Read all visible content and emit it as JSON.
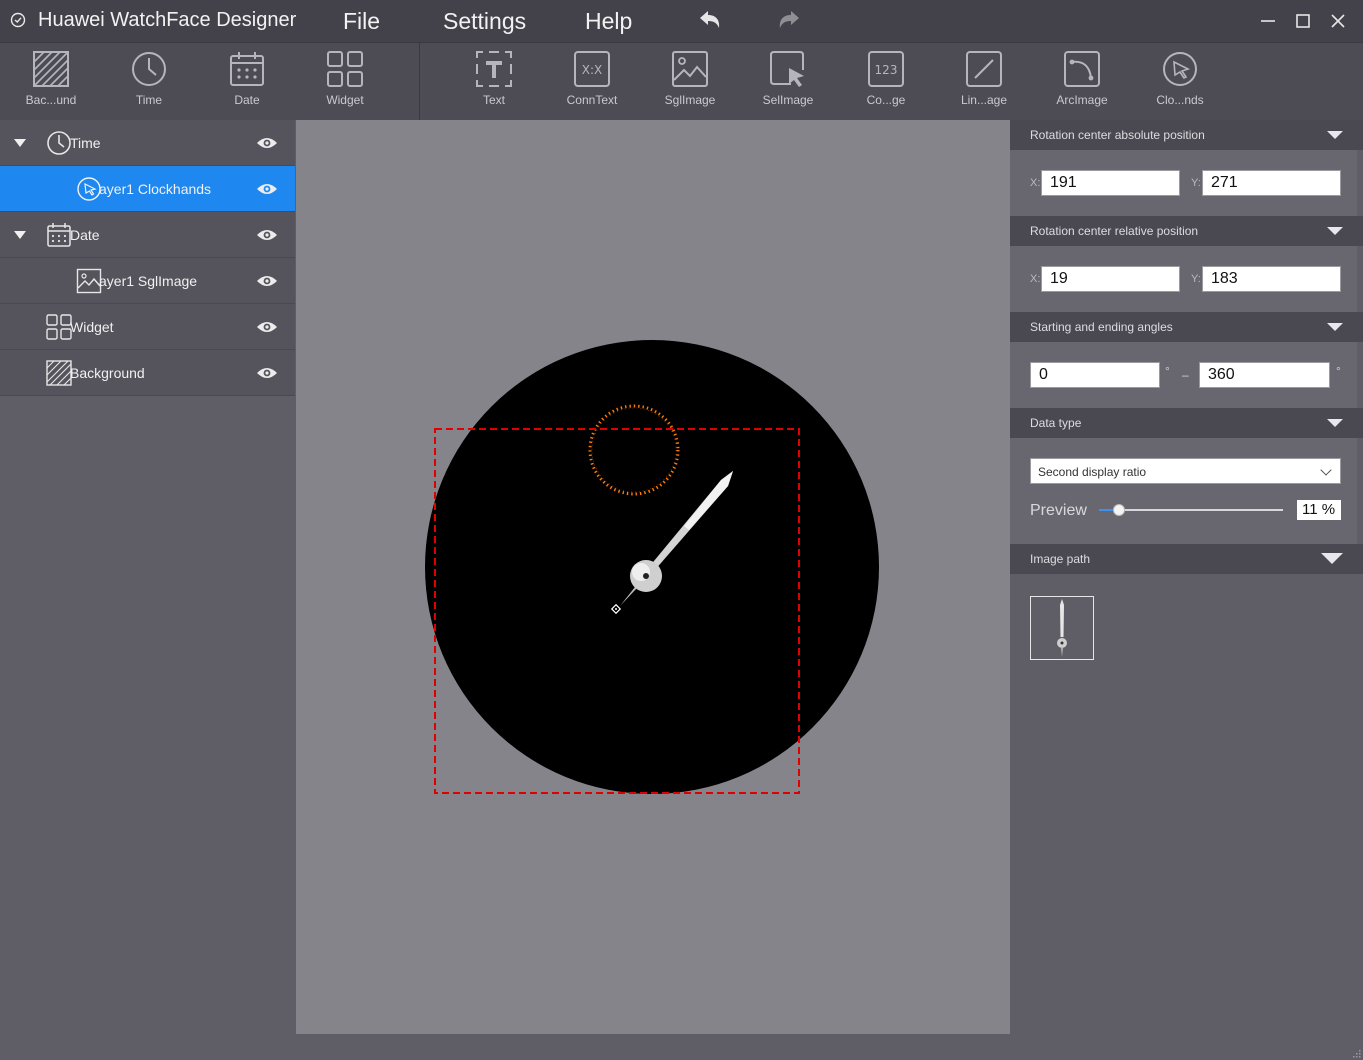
{
  "app": {
    "title": "Huawei WatchFace Designer"
  },
  "menu": {
    "file": "File",
    "settings": "Settings",
    "help": "Help"
  },
  "toolbar": {
    "left": [
      {
        "label": "Bac...und",
        "icon": "background-icon"
      },
      {
        "label": "Time",
        "icon": "clock-icon"
      },
      {
        "label": "Date",
        "icon": "calendar-icon"
      },
      {
        "label": "Widget",
        "icon": "widget-icon"
      }
    ],
    "right": [
      {
        "label": "Text",
        "icon": "text-icon"
      },
      {
        "label": "ConnText",
        "icon": "conntext-icon"
      },
      {
        "label": "SglImage",
        "icon": "image-icon"
      },
      {
        "label": "SelImage",
        "icon": "selimage-icon"
      },
      {
        "label": "Co...ge",
        "icon": "counter-image-icon"
      },
      {
        "label": "Lin...age",
        "icon": "line-image-icon"
      },
      {
        "label": "ArcImage",
        "icon": "arc-image-icon"
      },
      {
        "label": "Clo...nds",
        "icon": "clockhands-icon"
      }
    ]
  },
  "layers": [
    {
      "name": "Time",
      "icon": "clock-icon",
      "expandable": true,
      "indent": 0,
      "selected": false
    },
    {
      "name": "ayer1 Clockhands",
      "icon": "clockhands-icon",
      "expandable": false,
      "indent": 1,
      "selected": true
    },
    {
      "name": "Date",
      "icon": "calendar-icon",
      "expandable": true,
      "indent": 0,
      "selected": false
    },
    {
      "name": "ayer1 SglImage",
      "icon": "image-icon",
      "expandable": false,
      "indent": 1,
      "selected": false
    },
    {
      "name": "Widget",
      "icon": "widget-icon",
      "expandable": false,
      "indent": 0,
      "selected": false
    },
    {
      "name": "Background",
      "icon": "background-icon",
      "expandable": false,
      "indent": 0,
      "selected": false
    }
  ],
  "properties": {
    "abs_position": {
      "title": "Rotation center absolute position",
      "x_label": "X:",
      "y_label": "Y:",
      "x": "191",
      "y": "271"
    },
    "rel_position": {
      "title": "Rotation center relative position",
      "x_label": "X:",
      "y_label": "Y:",
      "x": "19",
      "y": "183"
    },
    "angles": {
      "title": "Starting and ending angles",
      "start": "0",
      "end": "360",
      "deg": "°",
      "sep": "–"
    },
    "data_type": {
      "title": "Data type",
      "selected": "Second display ratio",
      "preview_label": "Preview",
      "preview_percent": 11,
      "preview_text": "11 %"
    },
    "image_path": {
      "title": "Image path"
    }
  },
  "colors": {
    "accent": "#1e88f0",
    "selection_dash": "#e00000",
    "ring": "#ff7a00",
    "dial": "#000000"
  }
}
